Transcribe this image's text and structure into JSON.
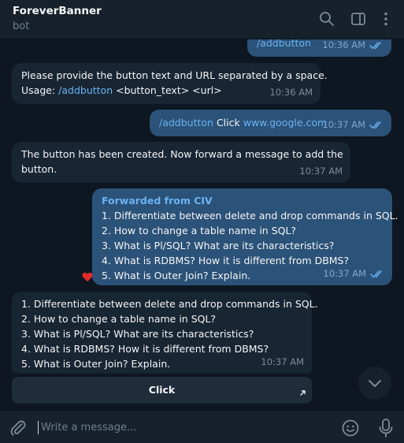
{
  "header": {
    "title": "ForeverBanner",
    "subtitle": "bot",
    "icons": [
      "search-icon",
      "sidebar-toggle-icon",
      "more-vertical-icon"
    ]
  },
  "messages": [
    {
      "direction": "outgoing",
      "command": "/addbutton",
      "time": "10:36 AM",
      "status": "read"
    },
    {
      "direction": "incoming",
      "line1": "Please provide the button text and URL separated by a space.",
      "usage_label": "Usage: ",
      "usage_command": "/addbutton",
      "usage_args": " <button_text> <url>",
      "time": "10:36 AM"
    },
    {
      "direction": "outgoing",
      "command": "/addbutton",
      "middle": " Click ",
      "url": "www.google.com",
      "time": "10:37 AM",
      "status": "read"
    },
    {
      "direction": "incoming",
      "line1": "The button has been created. Now forward a message to add the",
      "line2": "button.",
      "time": "10:37 AM"
    },
    {
      "direction": "outgoing",
      "forwarded_from": "Forwarded from CIV",
      "lines": [
        "1. Differentiate between delete and drop commands in SQL.",
        "2. How to change a table name in SQL?",
        "3. What is Pl/SQL? What are its characteristics?",
        "4. What is RDBMS? How it is different from DBMS?",
        "5. What is Outer Join? Explain."
      ],
      "time": "10:37 AM",
      "status": "read",
      "reaction": "heart"
    },
    {
      "direction": "incoming",
      "lines": [
        "1. Differentiate between delete and drop commands in SQL.",
        "2. How to change a table name in SQL?",
        "3. What is Pl/SQL? What are its characteristics?",
        "4. What is RDBMS? How it is different from DBMS?",
        "5. What is Outer Join? Explain."
      ],
      "time": "10:37 AM",
      "inline_button": "Click"
    }
  ],
  "composer": {
    "placeholder": "Write a message...",
    "value": ""
  },
  "colors": {
    "background": "#0e1621",
    "panel": "#17212b",
    "incoming_bubble": "#182533",
    "outgoing_bubble": "#2b5278",
    "link": "#6ab3f3",
    "accent_heart": "#e02b2b"
  }
}
